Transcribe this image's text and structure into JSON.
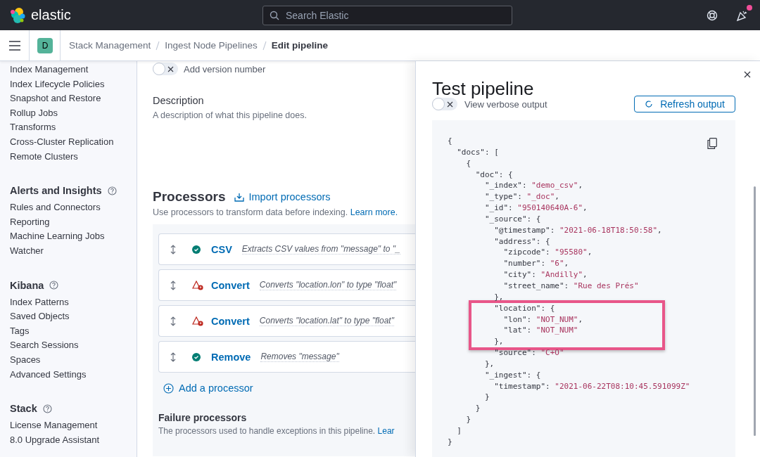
{
  "header": {
    "logo_text": "elastic",
    "search": {
      "placeholder": "Search Elastic"
    },
    "news_unread": true
  },
  "breadcrumb_bar": {
    "space_avatar": "D",
    "breadcrumbs": [
      {
        "label": "Stack Management",
        "current": false
      },
      {
        "label": "Ingest Node Pipelines",
        "current": false
      },
      {
        "label": "Edit pipeline",
        "current": true
      }
    ]
  },
  "sidebar": {
    "sections": [
      {
        "items": [
          "Index Management",
          "Index Lifecycle Policies",
          "Snapshot and Restore",
          "Rollup Jobs",
          "Transforms",
          "Cross-Cluster Replication",
          "Remote Clusters"
        ]
      },
      {
        "title": "Alerts and Insights",
        "items": [
          "Rules and Connectors",
          "Reporting",
          "Machine Learning Jobs",
          "Watcher"
        ]
      },
      {
        "title": "Kibana",
        "items": [
          "Index Patterns",
          "Saved Objects",
          "Tags",
          "Search Sessions",
          "Spaces",
          "Advanced Settings"
        ]
      },
      {
        "title": "Stack",
        "items": [
          "License Management",
          "8.0 Upgrade Assistant"
        ]
      }
    ]
  },
  "main": {
    "version_toggle": {
      "label": "Add version number",
      "on": false
    },
    "description": {
      "title": "Description",
      "text": "A description of what this pipeline does."
    },
    "processors": {
      "title": "Processors",
      "import_link": "Import processors",
      "subtitle": "Use processors to transform data before indexing.",
      "learn_more": "Learn more.",
      "items": [
        {
          "name": "CSV",
          "description": "Extracts CSV values from \"message\" to \"_",
          "kind": "ok"
        },
        {
          "name": "Convert",
          "description": "Converts \"location.lon\" to type \"float\"",
          "kind": "error"
        },
        {
          "name": "Convert",
          "description": "Converts \"location.lat\" to type \"float\"",
          "kind": "error"
        },
        {
          "name": "Remove",
          "description": "Removes \"message\"",
          "kind": "ok"
        }
      ],
      "add_link": "Add a processor"
    },
    "failure": {
      "title": "Failure processors",
      "text": "The processors used to handle exceptions in this pipeline.",
      "link": "Lear"
    }
  },
  "flyout": {
    "title": "Test pipeline",
    "verbose_toggle": {
      "label": "View verbose output",
      "on": false
    },
    "refresh_button": "Refresh output",
    "output_lines": [
      {
        "text": "{",
        "highlighted": false
      },
      {
        "text": "  \"docs\": [",
        "highlighted": false
      },
      {
        "text": "    {",
        "highlighted": false
      },
      {
        "text": "      \"doc\": {",
        "highlighted": false
      },
      {
        "text": "        \"_index\": ",
        "value": "\"demo_csv\"",
        "end": ",",
        "highlighted": false
      },
      {
        "text": "        \"_type\": ",
        "value": "\"_doc\"",
        "end": ",",
        "highlighted": false
      },
      {
        "text": "        \"_id\": ",
        "value": "\"950140640A-6\"",
        "end": ",",
        "highlighted": false
      },
      {
        "text": "        \"_source\": {",
        "highlighted": false
      },
      {
        "text": "          \"@timestamp\": ",
        "value": "\"2021-06-18T18:50:58\"",
        "end": ",",
        "highlighted": false
      },
      {
        "text": "          \"address\": {",
        "highlighted": false
      },
      {
        "text": "            \"zipcode\": ",
        "value": "\"95580\"",
        "end": ",",
        "highlighted": false
      },
      {
        "text": "            \"number\": ",
        "value": "\"6\"",
        "end": ",",
        "highlighted": false
      },
      {
        "text": "            \"city\": ",
        "value": "\"Andilly\"",
        "end": ",",
        "highlighted": false
      },
      {
        "text": "            \"street_name\": ",
        "value": "\"Rue des Prés\"",
        "highlighted": false
      },
      {
        "text": "          },",
        "highlighted": false
      },
      {
        "text": "          \"location\": {",
        "highlighted": true
      },
      {
        "text": "            \"lon\": ",
        "value": "\"NOT_NUM\"",
        "end": ",",
        "highlighted": true
      },
      {
        "text": "            \"lat\": ",
        "value": "\"NOT_NUM\"",
        "highlighted": true
      },
      {
        "text": "          },",
        "highlighted": true
      },
      {
        "text": "          \"source\": ",
        "value": "\"C+O\"",
        "highlighted": false
      },
      {
        "text": "        },",
        "highlighted": false
      },
      {
        "text": "        \"_ingest\": {",
        "highlighted": false
      },
      {
        "text": "          \"timestamp\": ",
        "value": "\"2021-06-22T08:10:45.591099Z\"",
        "highlighted": false
      },
      {
        "text": "        }",
        "highlighted": false
      },
      {
        "text": "      }",
        "highlighted": false
      },
      {
        "text": "    }",
        "highlighted": false
      },
      {
        "text": "  ]",
        "highlighted": false
      },
      {
        "text": "}",
        "highlighted": false
      }
    ]
  }
}
